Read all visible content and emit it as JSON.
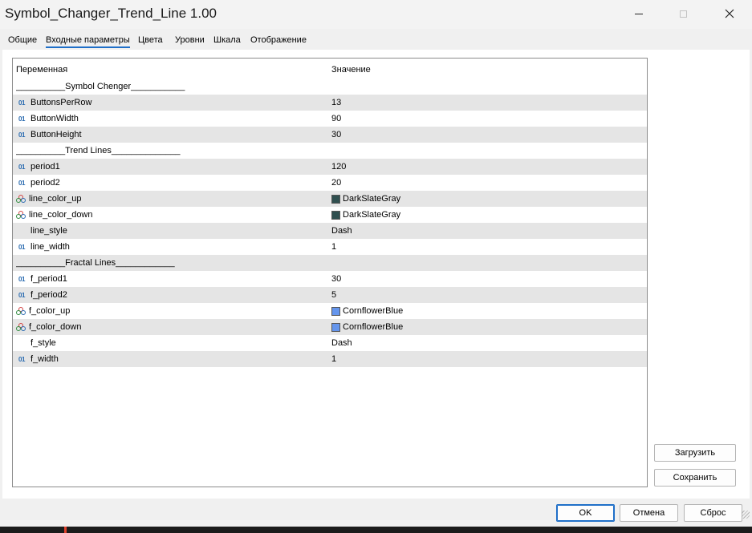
{
  "window": {
    "title": "Symbol_Changer_Trend_Line 1.00"
  },
  "tabs": [
    {
      "label": "Общие"
    },
    {
      "label": "Входные параметры"
    },
    {
      "label": "Цвета"
    },
    {
      "label": "Уровни"
    },
    {
      "label": "Шкала"
    },
    {
      "label": "Отображение"
    }
  ],
  "active_tab": "Входные параметры",
  "grid": {
    "headers": {
      "name": "Переменная",
      "value": "Значение"
    },
    "rows": [
      {
        "name": "__________Symbol Chenger___________",
        "value": "",
        "icon": "none"
      },
      {
        "name": "ButtonsPerRow",
        "value": "13",
        "icon": "int"
      },
      {
        "name": "ButtonWidth",
        "value": "90",
        "icon": "int"
      },
      {
        "name": "ButtonHeight",
        "value": "30",
        "icon": "int"
      },
      {
        "name": "__________Trend Lines______________",
        "value": "",
        "icon": "none"
      },
      {
        "name": "period1",
        "value": "120",
        "icon": "int"
      },
      {
        "name": "period2",
        "value": "20",
        "icon": "int"
      },
      {
        "name": "line_color_up",
        "value": "DarkSlateGray",
        "icon": "color",
        "swatch": "#2f4f4f"
      },
      {
        "name": "line_color_down",
        "value": "DarkSlateGray",
        "icon": "color",
        "swatch": "#2f4f4f"
      },
      {
        "name": "line_style",
        "value": "Dash",
        "icon": "style"
      },
      {
        "name": "line_width",
        "value": "1",
        "icon": "int"
      },
      {
        "name": "__________Fractal Lines____________",
        "value": "",
        "icon": "none"
      },
      {
        "name": "f_period1",
        "value": "30",
        "icon": "int"
      },
      {
        "name": "f_period2",
        "value": "5",
        "icon": "int"
      },
      {
        "name": "f_color_up",
        "value": "CornflowerBlue",
        "icon": "color",
        "swatch": "#6495ed"
      },
      {
        "name": "f_color_down",
        "value": "CornflowerBlue",
        "icon": "color",
        "swatch": "#6495ed"
      },
      {
        "name": "f_style",
        "value": "Dash",
        "icon": "style"
      },
      {
        "name": "f_width",
        "value": "1",
        "icon": "int"
      }
    ]
  },
  "int_icon_text": "01",
  "side_buttons": {
    "load": "Загрузить",
    "save": "Сохранить"
  },
  "footer": {
    "ok": "OK",
    "cancel": "Отмена",
    "reset": "Сброс"
  },
  "colors": {
    "accent": "#1f6fc8",
    "row_alt": "#e5e5e5"
  }
}
